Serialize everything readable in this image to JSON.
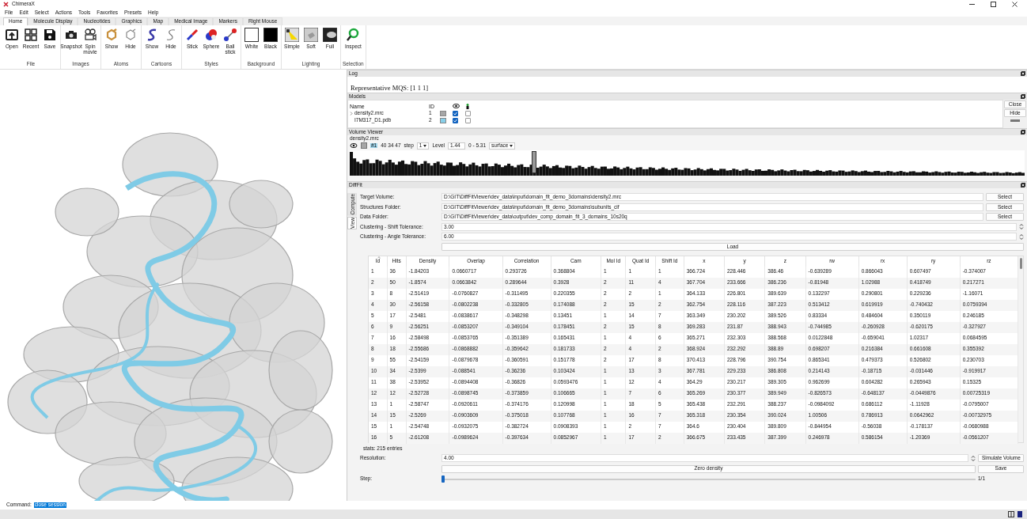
{
  "window": {
    "title": "ChimeraX"
  },
  "menu": [
    "File",
    "Edit",
    "Select",
    "Actions",
    "Tools",
    "Favorites",
    "Presets",
    "Help"
  ],
  "ribbon_tabs": [
    {
      "label": "Home",
      "selected": true
    },
    {
      "label": "Molecule Display",
      "selected": false
    },
    {
      "label": "Nucleotides",
      "selected": false
    },
    {
      "label": "Graphics",
      "selected": false
    },
    {
      "label": "Map",
      "selected": false
    },
    {
      "label": "Medical Image",
      "selected": false
    },
    {
      "label": "Markers",
      "selected": false
    },
    {
      "label": "Right Mouse",
      "selected": false
    }
  ],
  "toolbar_groups": [
    {
      "label": "File",
      "buttons": [
        "Open",
        "Recent",
        "Save"
      ]
    },
    {
      "label": "Images",
      "buttons": [
        "Snapshot",
        "Spin movie"
      ]
    },
    {
      "label": "Atoms",
      "buttons": [
        "Show",
        "Hide"
      ]
    },
    {
      "label": "Cartoons",
      "buttons": [
        "Show",
        "Hide"
      ]
    },
    {
      "label": "Styles",
      "buttons": [
        "Stick",
        "Sphere",
        "Ball stick"
      ]
    },
    {
      "label": "Background",
      "buttons": [
        "White",
        "Black"
      ]
    },
    {
      "label": "Lighting",
      "buttons": [
        "Simple",
        "Soft",
        "Full"
      ]
    },
    {
      "label": "Selection",
      "buttons": [
        "Inspect"
      ]
    }
  ],
  "log": {
    "title": "Log",
    "lines": [
      "Representative MQS: [1 1 1]"
    ]
  },
  "models": {
    "title": "Models",
    "columns": [
      "Name",
      "ID"
    ],
    "rows": [
      {
        "name": "density2.mrc",
        "id": "1",
        "color": "#a6a6a6",
        "shown": true,
        "selected": false,
        "expandable": true
      },
      {
        "name": "I7M317_D1.pdb",
        "id": "2",
        "color": "#87cfe9",
        "shown": true,
        "selected": false,
        "expandable": false
      }
    ],
    "buttons": [
      "Close",
      "Hide"
    ]
  },
  "volume_viewer": {
    "title": "Volume Viewer",
    "map_name": "density2.mrc",
    "model_id": "#1",
    "size": "40 34 47",
    "step_label": "step",
    "step": "1",
    "level_label": "Level",
    "level_value": "1.44",
    "range": "0 - 5.31",
    "style": "surface",
    "threshold": {
      "level": 0.27
    }
  },
  "difffit": {
    "title": "DiffFit",
    "side_tabs": [
      {
        "label": "Compute",
        "selected": false
      },
      {
        "label": "View",
        "selected": true
      }
    ],
    "fields": [
      {
        "kind": "path",
        "label": "Target Volume:",
        "value": "D:\\GIT\\DiffFitViewer\\dev_data\\input\\domain_fit_demo_3domains\\density2.mrc",
        "button": "Select"
      },
      {
        "kind": "path",
        "label": "Structures Folder:",
        "value": "D:\\GIT\\DiffFitViewer\\dev_data\\input\\domain_fit_demo_3domains\\subunits_cif",
        "button": "Select"
      },
      {
        "kind": "path",
        "label": "Data Folder:",
        "value": "D:\\GIT\\DiffFitViewer\\dev_data\\output\\dev_comp_domain_fit_3_domains_10s20q",
        "button": "Select"
      },
      {
        "kind": "spin",
        "label": "Clustering - Shift Tolerance:",
        "value": "3.00"
      },
      {
        "kind": "spin",
        "label": "Clustering - Angle Tolerance:",
        "value": "6.00"
      }
    ],
    "load_button": "Load",
    "table": {
      "columns": [
        "Id",
        "Hits",
        "Density",
        "Overlap",
        "Correlation",
        "Cam",
        "Mol Id",
        "Quat Id",
        "Shift Id",
        "x",
        "y",
        "z",
        "rw",
        "rx",
        "ry",
        "rz"
      ],
      "rows": [
        [
          "1",
          "36",
          "-1.84203",
          "0.0660717",
          "0.293726",
          "0.368804",
          "1",
          "1",
          "1",
          "366.724",
          "228.446",
          "386.46",
          "-0.639289",
          "0.866043",
          "0.607497",
          "-0.374007"
        ],
        [
          "2",
          "50",
          "-1.8574",
          "0.0663842",
          "0.289644",
          "0.3928",
          "2",
          "11",
          "4",
          "367.704",
          "233.666",
          "386.236",
          "-0.81948",
          "1.02988",
          "0.418749",
          "0.217271"
        ],
        [
          "3",
          "8",
          "-2.51419",
          "-0.0760827",
          "-0.311495",
          "0.220355",
          "2",
          "2",
          "1",
          "364.133",
          "226.801",
          "389.639",
          "0.132297",
          "0.290801",
          "0.229236",
          "-1.16071"
        ],
        [
          "4",
          "30",
          "-2.56158",
          "-0.0802238",
          "-0.332805",
          "0.174088",
          "2",
          "15",
          "2",
          "362.754",
          "228.116",
          "387.223",
          "0.513412",
          "0.619919",
          "-0.740432",
          "0.0759394"
        ],
        [
          "5",
          "17",
          "-2.5481",
          "-0.0838617",
          "-0.348298",
          "0.13451",
          "1",
          "14",
          "7",
          "363.349",
          "230.202",
          "389.526",
          "0.83334",
          "0.484604",
          "0.350119",
          "0.246185"
        ],
        [
          "6",
          "9",
          "-2.56251",
          "-0.0853207",
          "-0.349104",
          "0.178451",
          "2",
          "15",
          "8",
          "369.283",
          "231.87",
          "388.943",
          "-0.744985",
          "-0.260928",
          "-0.620175",
          "-0.327927"
        ],
        [
          "7",
          "16",
          "-2.58498",
          "-0.0853765",
          "-0.351389",
          "0.165431",
          "1",
          "4",
          "6",
          "365.271",
          "232.303",
          "388.568",
          "0.0122848",
          "-0.659041",
          "1.02317",
          "0.0684595"
        ],
        [
          "8",
          "18",
          "-2.55686",
          "-0.0868882",
          "-0.359642",
          "0.181733",
          "2",
          "4",
          "2",
          "368.924",
          "232.292",
          "388.89",
          "0.698207",
          "0.216384",
          "0.661608",
          "0.355392"
        ],
        [
          "9",
          "55",
          "-2.54159",
          "-0.0879678",
          "-0.360591",
          "0.151778",
          "2",
          "17",
          "8",
          "370.413",
          "228.796",
          "390.754",
          "0.865341",
          "0.479373",
          "0.526802",
          "0.230703"
        ],
        [
          "10",
          "34",
          "-2.5399",
          "-0.088541",
          "-0.36236",
          "0.103424",
          "1",
          "13",
          "3",
          "367.781",
          "229.233",
          "386.808",
          "0.214143",
          "-0.18715",
          "-0.031446",
          "-0.919917"
        ],
        [
          "11",
          "38",
          "-2.53952",
          "-0.0894408",
          "-0.36826",
          "0.0593476",
          "1",
          "12",
          "4",
          "364.29",
          "230.217",
          "389.305",
          "0.962699",
          "0.604282",
          "0.265943",
          "0.15325"
        ],
        [
          "12",
          "12",
          "-2.52728",
          "-0.0898745",
          "-0.373859",
          "0.106665",
          "1",
          "7",
          "6",
          "365.269",
          "230.377",
          "389.949",
          "-0.826573",
          "-0.648137",
          "-0.0449876",
          "0.00725319"
        ],
        [
          "13",
          "1",
          "-2.58747",
          "-0.0920611",
          "-0.374176",
          "0.120998",
          "1",
          "18",
          "5",
          "365.438",
          "232.291",
          "388.237",
          "-0.0984092",
          "0.686112",
          "-1.11928",
          "-0.0795007"
        ],
        [
          "14",
          "15",
          "-2.5269",
          "-0.0903609",
          "-0.375018",
          "0.107768",
          "1",
          "16",
          "7",
          "365.318",
          "230.354",
          "390.024",
          "1.00506",
          "0.786913",
          "0.0642962",
          "-0.00732975"
        ],
        [
          "15",
          "1",
          "-2.54748",
          "-0.0932075",
          "-0.382724",
          "0.0908393",
          "1",
          "2",
          "7",
          "364.6",
          "230.404",
          "389.809",
          "-0.844954",
          "-0.56038",
          "-0.178137",
          "-0.0680988"
        ],
        [
          "16",
          "5",
          "-2.61208",
          "-0.0989624",
          "-0.397634",
          "0.0852967",
          "1",
          "17",
          "2",
          "366.675",
          "233.435",
          "387.399",
          "0.246978",
          "0.586154",
          "-1.20369",
          "-0.0561207"
        ]
      ]
    },
    "stats": "stats: 215 entries",
    "resolution": {
      "label": "Resolution:",
      "value": "4.00",
      "button": "Simulate Volume"
    },
    "zero_density_button": "Zero density",
    "save_button": "Save",
    "step": {
      "label": "Step:",
      "level": 0,
      "reading": "1/1"
    }
  },
  "command": {
    "label": "Command:",
    "value": "close session"
  }
}
